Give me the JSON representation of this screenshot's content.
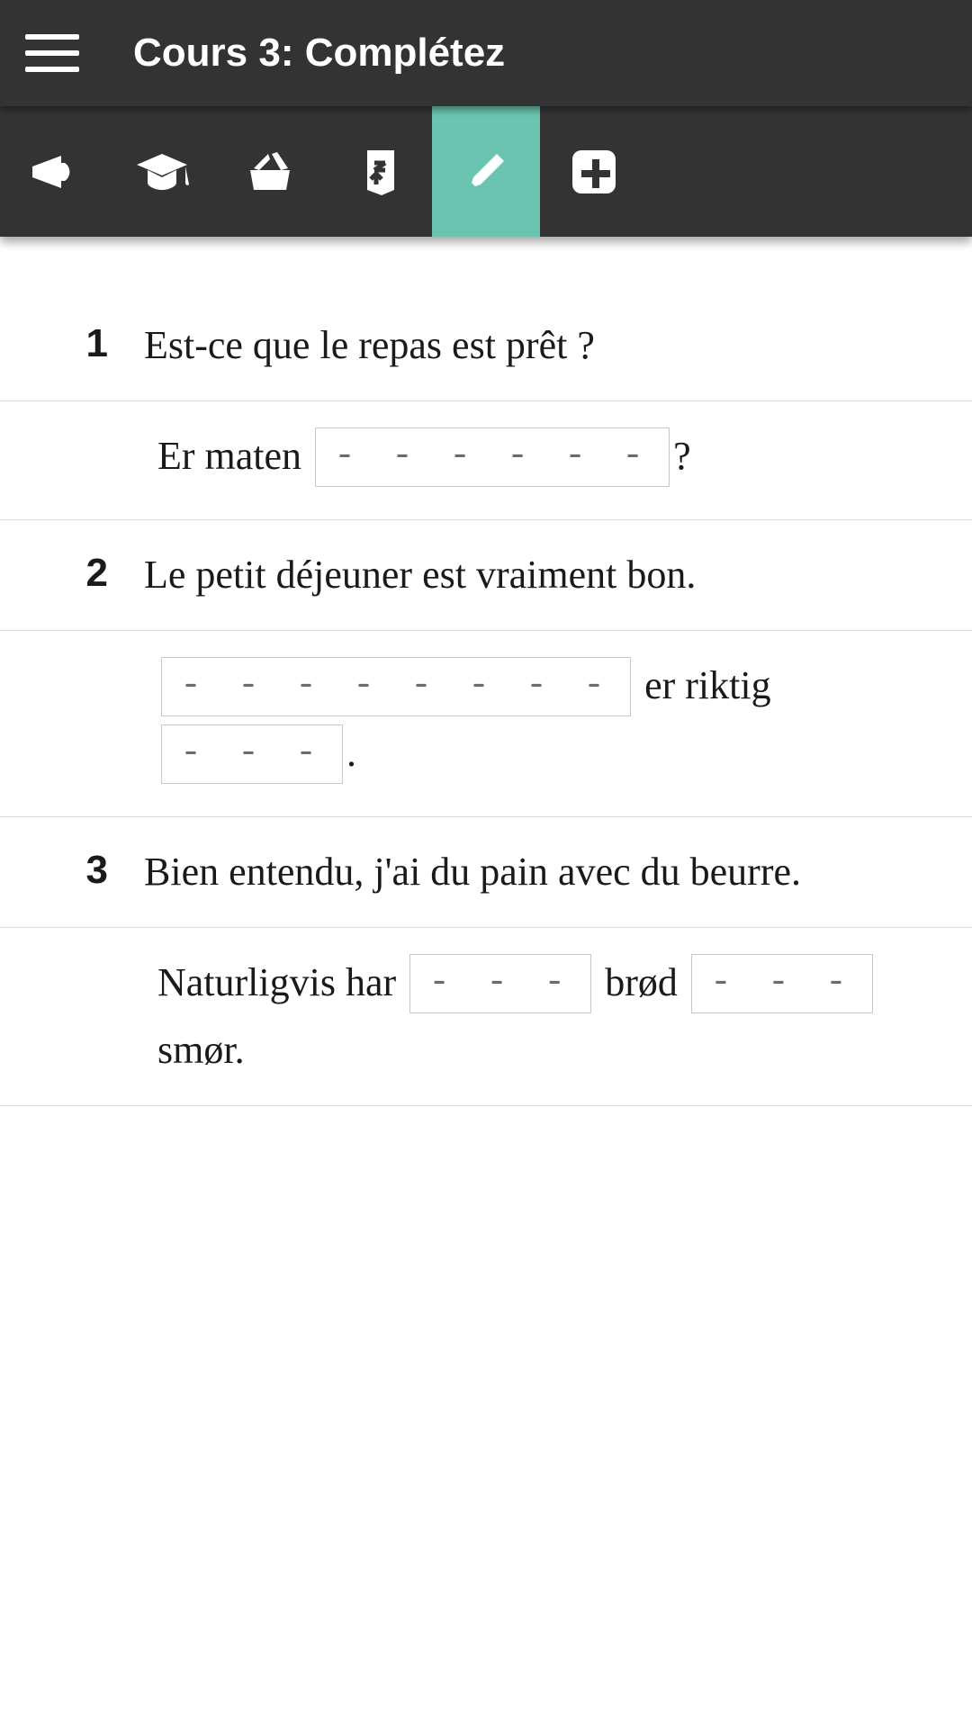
{
  "header": {
    "title": "Cours 3: Complétez"
  },
  "tabs": [
    {
      "name": "megaphone-icon",
      "active": false
    },
    {
      "name": "graduation-cap-icon",
      "active": false
    },
    {
      "name": "inbox-icon",
      "active": false
    },
    {
      "name": "swap-icon",
      "active": false
    },
    {
      "name": "pencil-icon",
      "active": true
    },
    {
      "name": "plus-icon",
      "active": false
    }
  ],
  "exercises": [
    {
      "num": "1",
      "prompt": "Est-ce que le repas est prêt ?",
      "answer_parts": [
        {
          "type": "text",
          "value": "Er maten "
        },
        {
          "type": "blank",
          "placeholder": "- - - - - -"
        },
        {
          "type": "text",
          "value": "?"
        }
      ]
    },
    {
      "num": "2",
      "prompt": "Le petit déjeuner est vraiment bon.",
      "answer_parts": [
        {
          "type": "blank",
          "placeholder": "- - - - - - - -"
        },
        {
          "type": "text",
          "value": " er riktig "
        },
        {
          "type": "blank",
          "placeholder": "- - -"
        },
        {
          "type": "text",
          "value": "."
        }
      ]
    },
    {
      "num": "3",
      "prompt": "Bien entendu, j'ai du pain avec du beurre.",
      "answer_parts": [
        {
          "type": "text",
          "value": "Naturligvis har "
        },
        {
          "type": "blank",
          "placeholder": "- - -"
        },
        {
          "type": "text",
          "value": " brød "
        },
        {
          "type": "blank",
          "placeholder": "- - -"
        },
        {
          "type": "text",
          "value": " smør."
        }
      ]
    }
  ]
}
